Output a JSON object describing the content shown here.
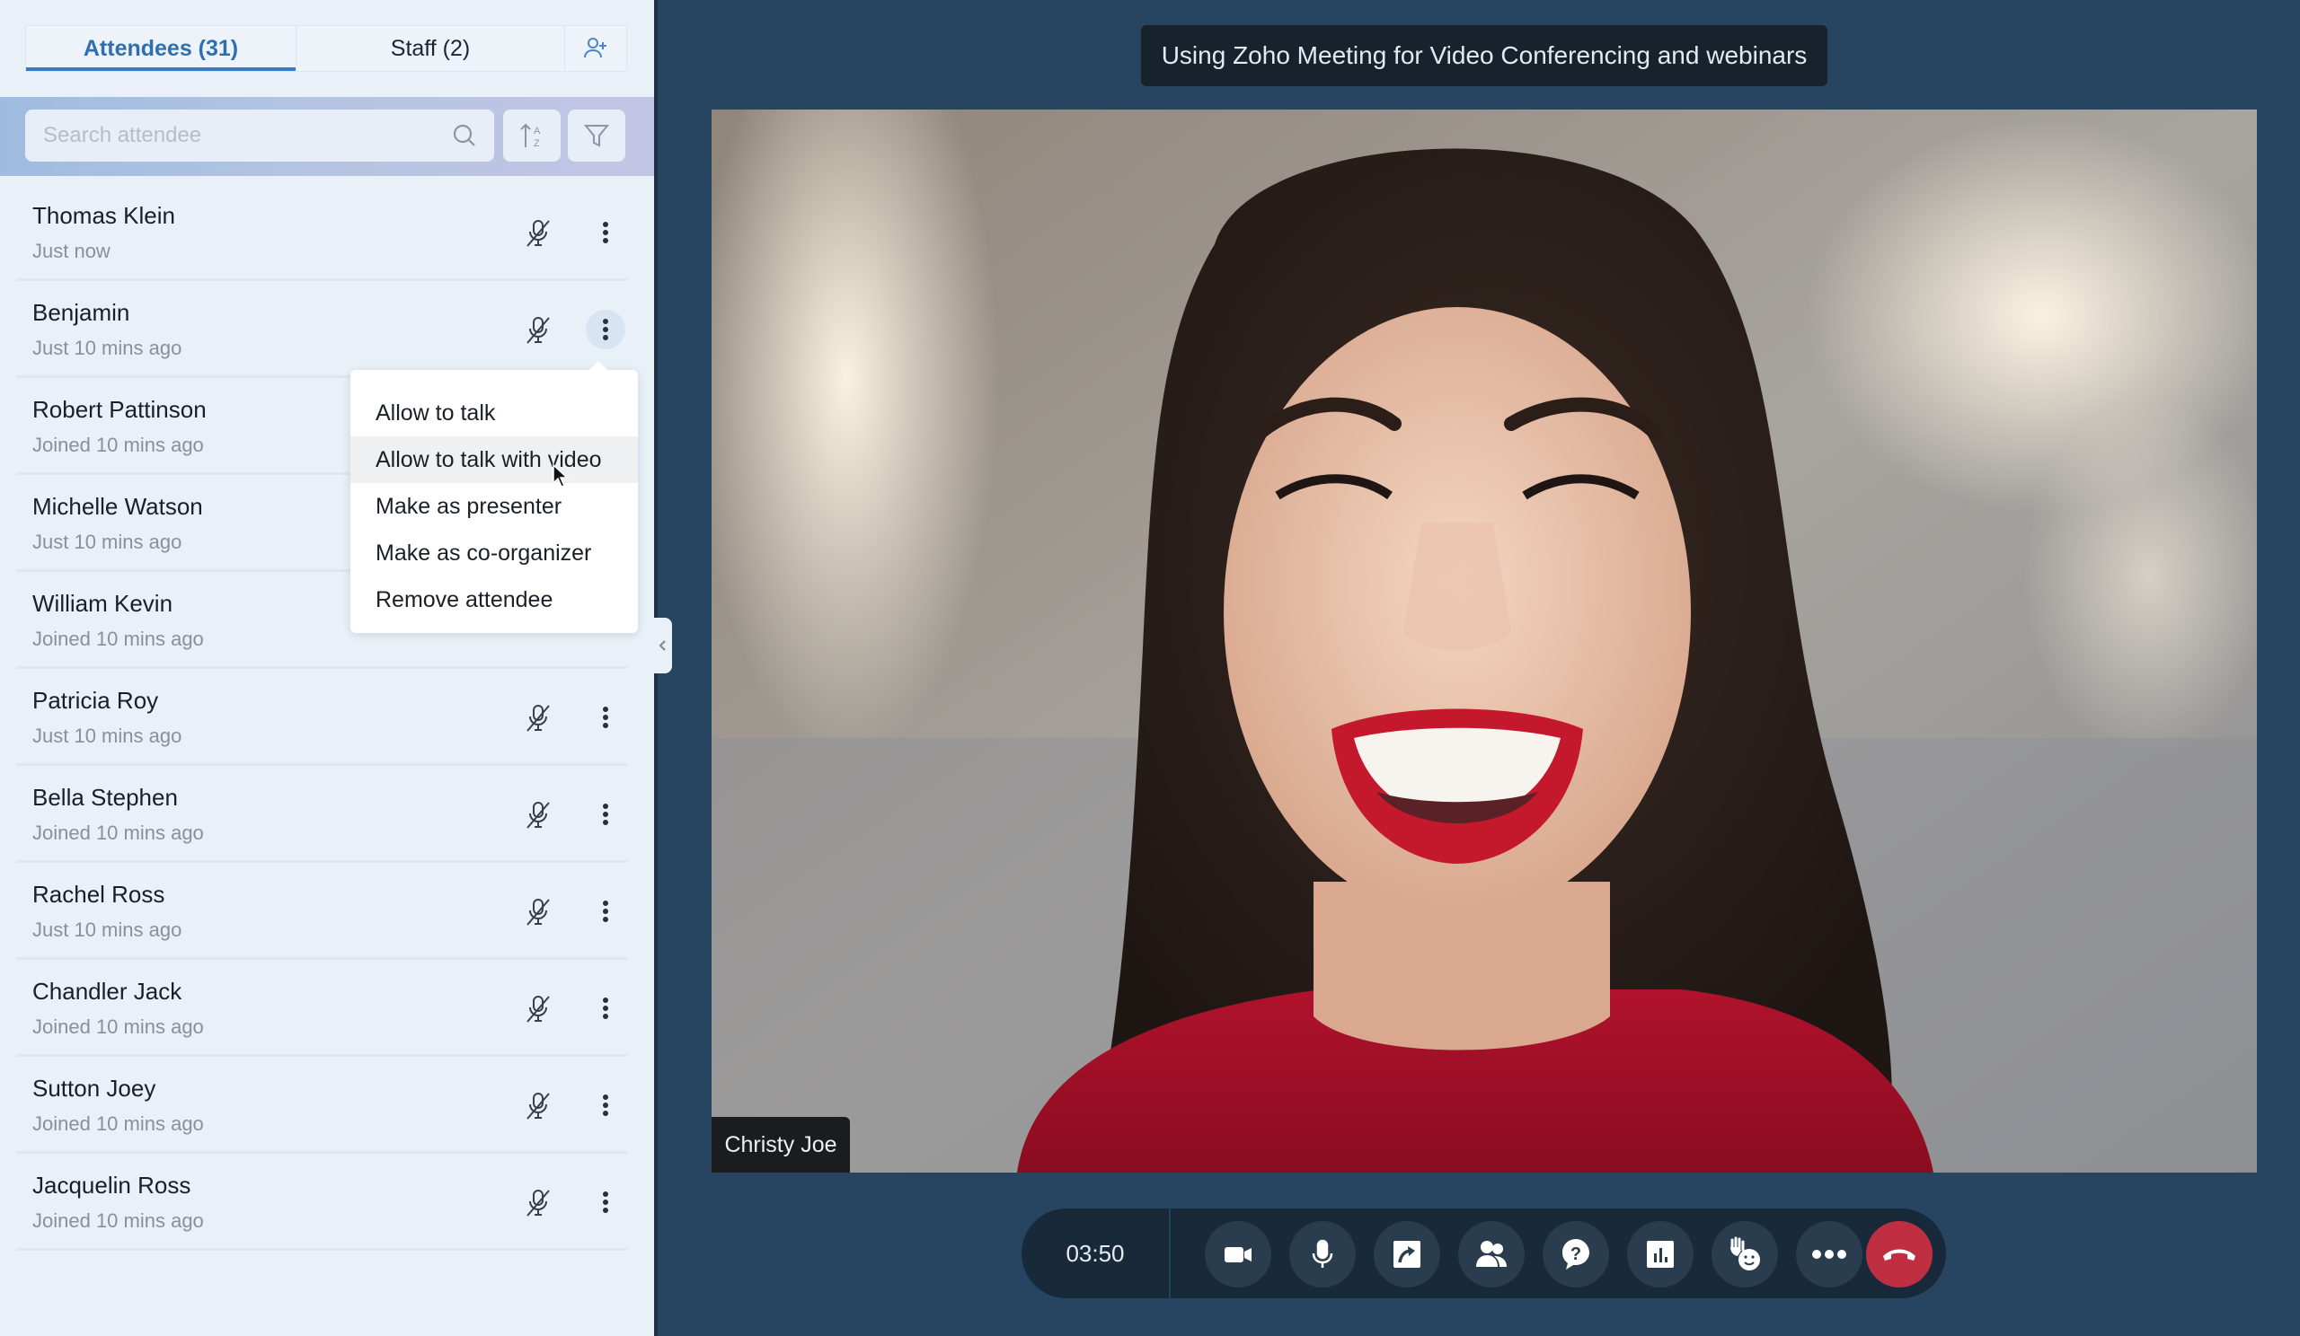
{
  "sidebar": {
    "tabs": [
      {
        "label": "Attendees (31)",
        "active": true
      },
      {
        "label": "Staff (2)",
        "active": false
      }
    ],
    "add_user_icon": "user-plus-icon",
    "search": {
      "placeholder": "Search attendee",
      "value": ""
    },
    "sort_icon": "sort-az-icon",
    "filter_icon": "filter-icon",
    "attendees": [
      {
        "name": "Thomas Klein",
        "status": "Just now"
      },
      {
        "name": "Benjamin",
        "status": "Just 10 mins ago"
      },
      {
        "name": "Robert Pattinson",
        "status": "Joined 10 mins ago"
      },
      {
        "name": "Michelle Watson",
        "status": "Just 10 mins ago"
      },
      {
        "name": "William Kevin",
        "status": "Joined 10 mins ago"
      },
      {
        "name": "Patricia Roy",
        "status": "Just 10 mins ago"
      },
      {
        "name": "Bella Stephen",
        "status": "Joined 10 mins ago"
      },
      {
        "name": "Rachel Ross",
        "status": "Just 10 mins ago"
      },
      {
        "name": "Chandler Jack",
        "status": "Joined 10 mins ago"
      },
      {
        "name": "Sutton Joey",
        "status": "Joined 10 mins ago"
      },
      {
        "name": "Jacquelin Ross",
        "status": "Joined 10 mins ago"
      }
    ],
    "context_menu": {
      "for_attendee": "Benjamin",
      "items": [
        {
          "label": "Allow to talk"
        },
        {
          "label": "Allow to talk with video",
          "hovered": true
        },
        {
          "label": "Make as presenter"
        },
        {
          "label": "Make as co-organizer"
        },
        {
          "label": "Remove attendee"
        }
      ]
    }
  },
  "main": {
    "session_title": "Using Zoho Meeting for Video Conferencing and webinars",
    "speaker_name": "Christy Joe",
    "controls": {
      "timer": "03:50",
      "buttons": [
        {
          "name": "camera",
          "icon": "video-camera-icon"
        },
        {
          "name": "microphone",
          "icon": "microphone-icon"
        },
        {
          "name": "share-screen",
          "icon": "share-screen-icon"
        },
        {
          "name": "participants",
          "icon": "participants-icon"
        },
        {
          "name": "questions",
          "icon": "question-icon"
        },
        {
          "name": "polls",
          "icon": "poll-chart-icon"
        },
        {
          "name": "raise-hand",
          "icon": "raise-hand-icon"
        },
        {
          "name": "more",
          "icon": "more-horizontal-icon"
        },
        {
          "name": "end-call",
          "icon": "end-call-icon"
        }
      ]
    }
  },
  "colors": {
    "accent": "#3a78c2",
    "sidebar_bg": "#e9f0f8",
    "main_bg": "#274560",
    "end_call": "#c02e42",
    "control_bar": "#18293a"
  }
}
